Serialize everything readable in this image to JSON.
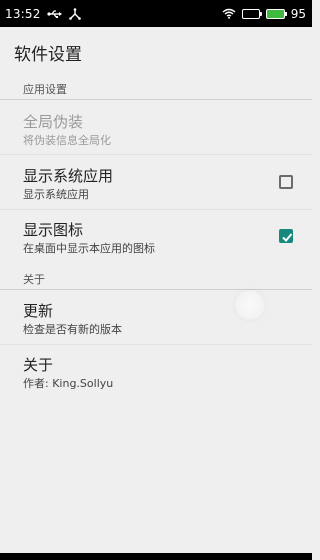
{
  "status_bar": {
    "time": "13:52",
    "battery_level": "95",
    "icons": [
      "usb-icon",
      "share-icon",
      "wifi-icon",
      "battery-outline-icon",
      "battery-charging-icon"
    ]
  },
  "app_bar": {
    "title": "软件设置"
  },
  "sections": {
    "app_settings": {
      "header": "应用设置",
      "items": [
        {
          "title": "全局伪装",
          "summary": "将伪装信息全局化",
          "enabled": false
        },
        {
          "title": "显示系统应用",
          "summary": "显示系统应用",
          "checked": false
        },
        {
          "title": "显示图标",
          "summary": "在桌面中显示本应用的图标",
          "checked": true
        }
      ]
    },
    "about": {
      "header": "关于",
      "items": [
        {
          "title": "更新",
          "summary": "检查是否有新的版本"
        },
        {
          "title": "关于",
          "summary": "作者: King.Sollyu"
        }
      ]
    }
  },
  "colors": {
    "status_bar_bg": "#000000",
    "background": "#efefef",
    "checkbox_checked": "#16897c",
    "battery_green": "#3fb93f"
  }
}
